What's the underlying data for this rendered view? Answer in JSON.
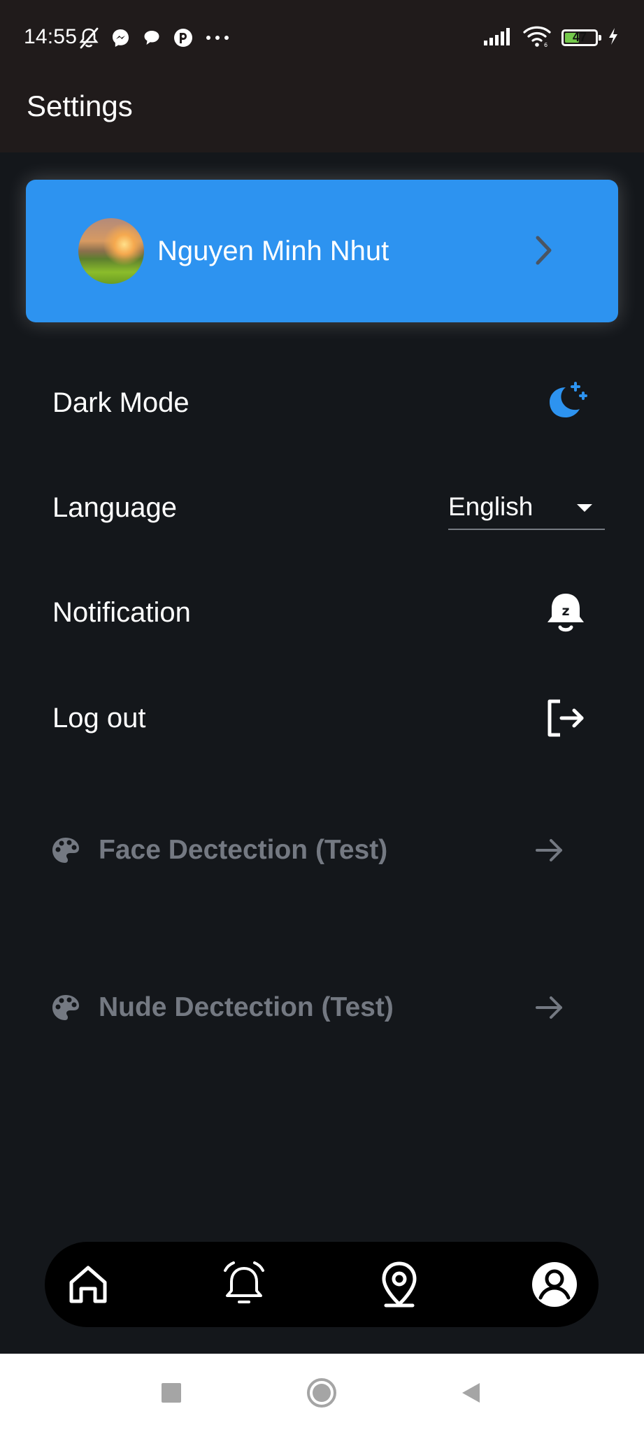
{
  "status_bar": {
    "time": "14:55",
    "battery_level": 47,
    "battery_text": "47",
    "left_icons": [
      "mute-icon",
      "messenger-icon",
      "chat-bubble-icon",
      "notification-app-icon",
      "more-dots-icon"
    ],
    "right_icons": [
      "signal-icon",
      "wifi-icon",
      "battery-icon",
      "charging-icon"
    ]
  },
  "app_bar": {
    "title": "Settings"
  },
  "profile": {
    "name": "Nguyen Minh Nhut",
    "icon": "chevron-right-icon"
  },
  "settings": {
    "dark_mode": {
      "label": "Dark Mode",
      "icon": "moon-icon"
    },
    "language": {
      "label": "Language",
      "value": "English",
      "icon": "dropdown-arrow-icon"
    },
    "notification": {
      "label": "Notification",
      "icon": "bell-snooze-icon"
    },
    "logout": {
      "label": "Log out",
      "icon": "logout-icon"
    }
  },
  "test_items": [
    {
      "label": "Face Dectection (Test)",
      "icon": "palette-icon",
      "action_icon": "arrow-right-icon"
    },
    {
      "label": "Nude Dectection (Test)",
      "icon": "palette-icon",
      "action_icon": "arrow-right-icon"
    }
  ],
  "bottom_nav": {
    "items": [
      {
        "name": "home",
        "icon": "home-icon"
      },
      {
        "name": "alerts",
        "icon": "alarm-icon"
      },
      {
        "name": "location",
        "icon": "location-pin-icon"
      },
      {
        "name": "profile",
        "icon": "account-icon"
      }
    ]
  },
  "system_nav": {
    "buttons": [
      "recents-icon",
      "home-circle-icon",
      "back-icon"
    ]
  },
  "colors": {
    "background": "#14171b",
    "top_bar": "#201b1b",
    "accent": "#2d93f0",
    "muted_text": "#747982",
    "bottom_nav": "#000000",
    "system_nav": "#ffffff"
  }
}
